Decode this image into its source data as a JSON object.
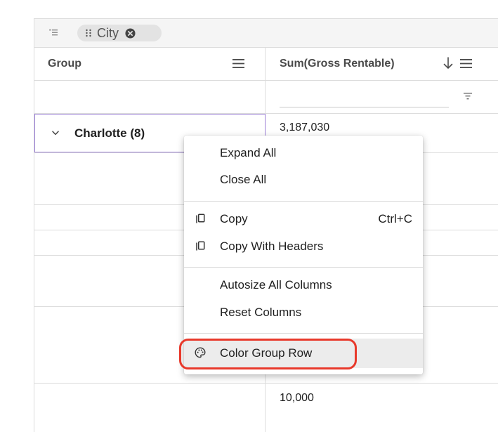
{
  "group_panel": {
    "chip_label": "City",
    "icons": {
      "panel": "group-by-panel-icon",
      "drag": "drag-handle-icon",
      "remove": "remove-chip-icon"
    }
  },
  "columns": {
    "group": {
      "label": "Group",
      "menu_icon": "column-menu-icon"
    },
    "sum_gross_rentable": {
      "label": "Sum(Gross Rentable)",
      "sort_icon": "sort-descending-icon",
      "menu_icon": "column-menu-icon",
      "filter_icon": "filter-icon"
    }
  },
  "rows": [
    {
      "group_label": "Charlotte (8)",
      "value": "3,187,030",
      "expanded": false
    },
    {
      "group_label": "",
      "value": "10,000"
    }
  ],
  "context_menu": {
    "items": [
      {
        "label": "Expand All",
        "icon": ""
      },
      {
        "label": "Close All",
        "icon": ""
      },
      {
        "label": "Copy",
        "icon": "copy-icon",
        "shortcut": "Ctrl+C"
      },
      {
        "label": "Copy With Headers",
        "icon": "copy-icon"
      },
      {
        "label": "Autosize All Columns",
        "icon": ""
      },
      {
        "label": "Reset Columns",
        "icon": ""
      },
      {
        "label": "Color Group Row",
        "icon": "palette-icon",
        "highlighted": true
      }
    ]
  },
  "colors": {
    "selection_border": "#9b7fd6",
    "annotation_ring": "#e8392b",
    "menu_hover": "#ececec"
  }
}
